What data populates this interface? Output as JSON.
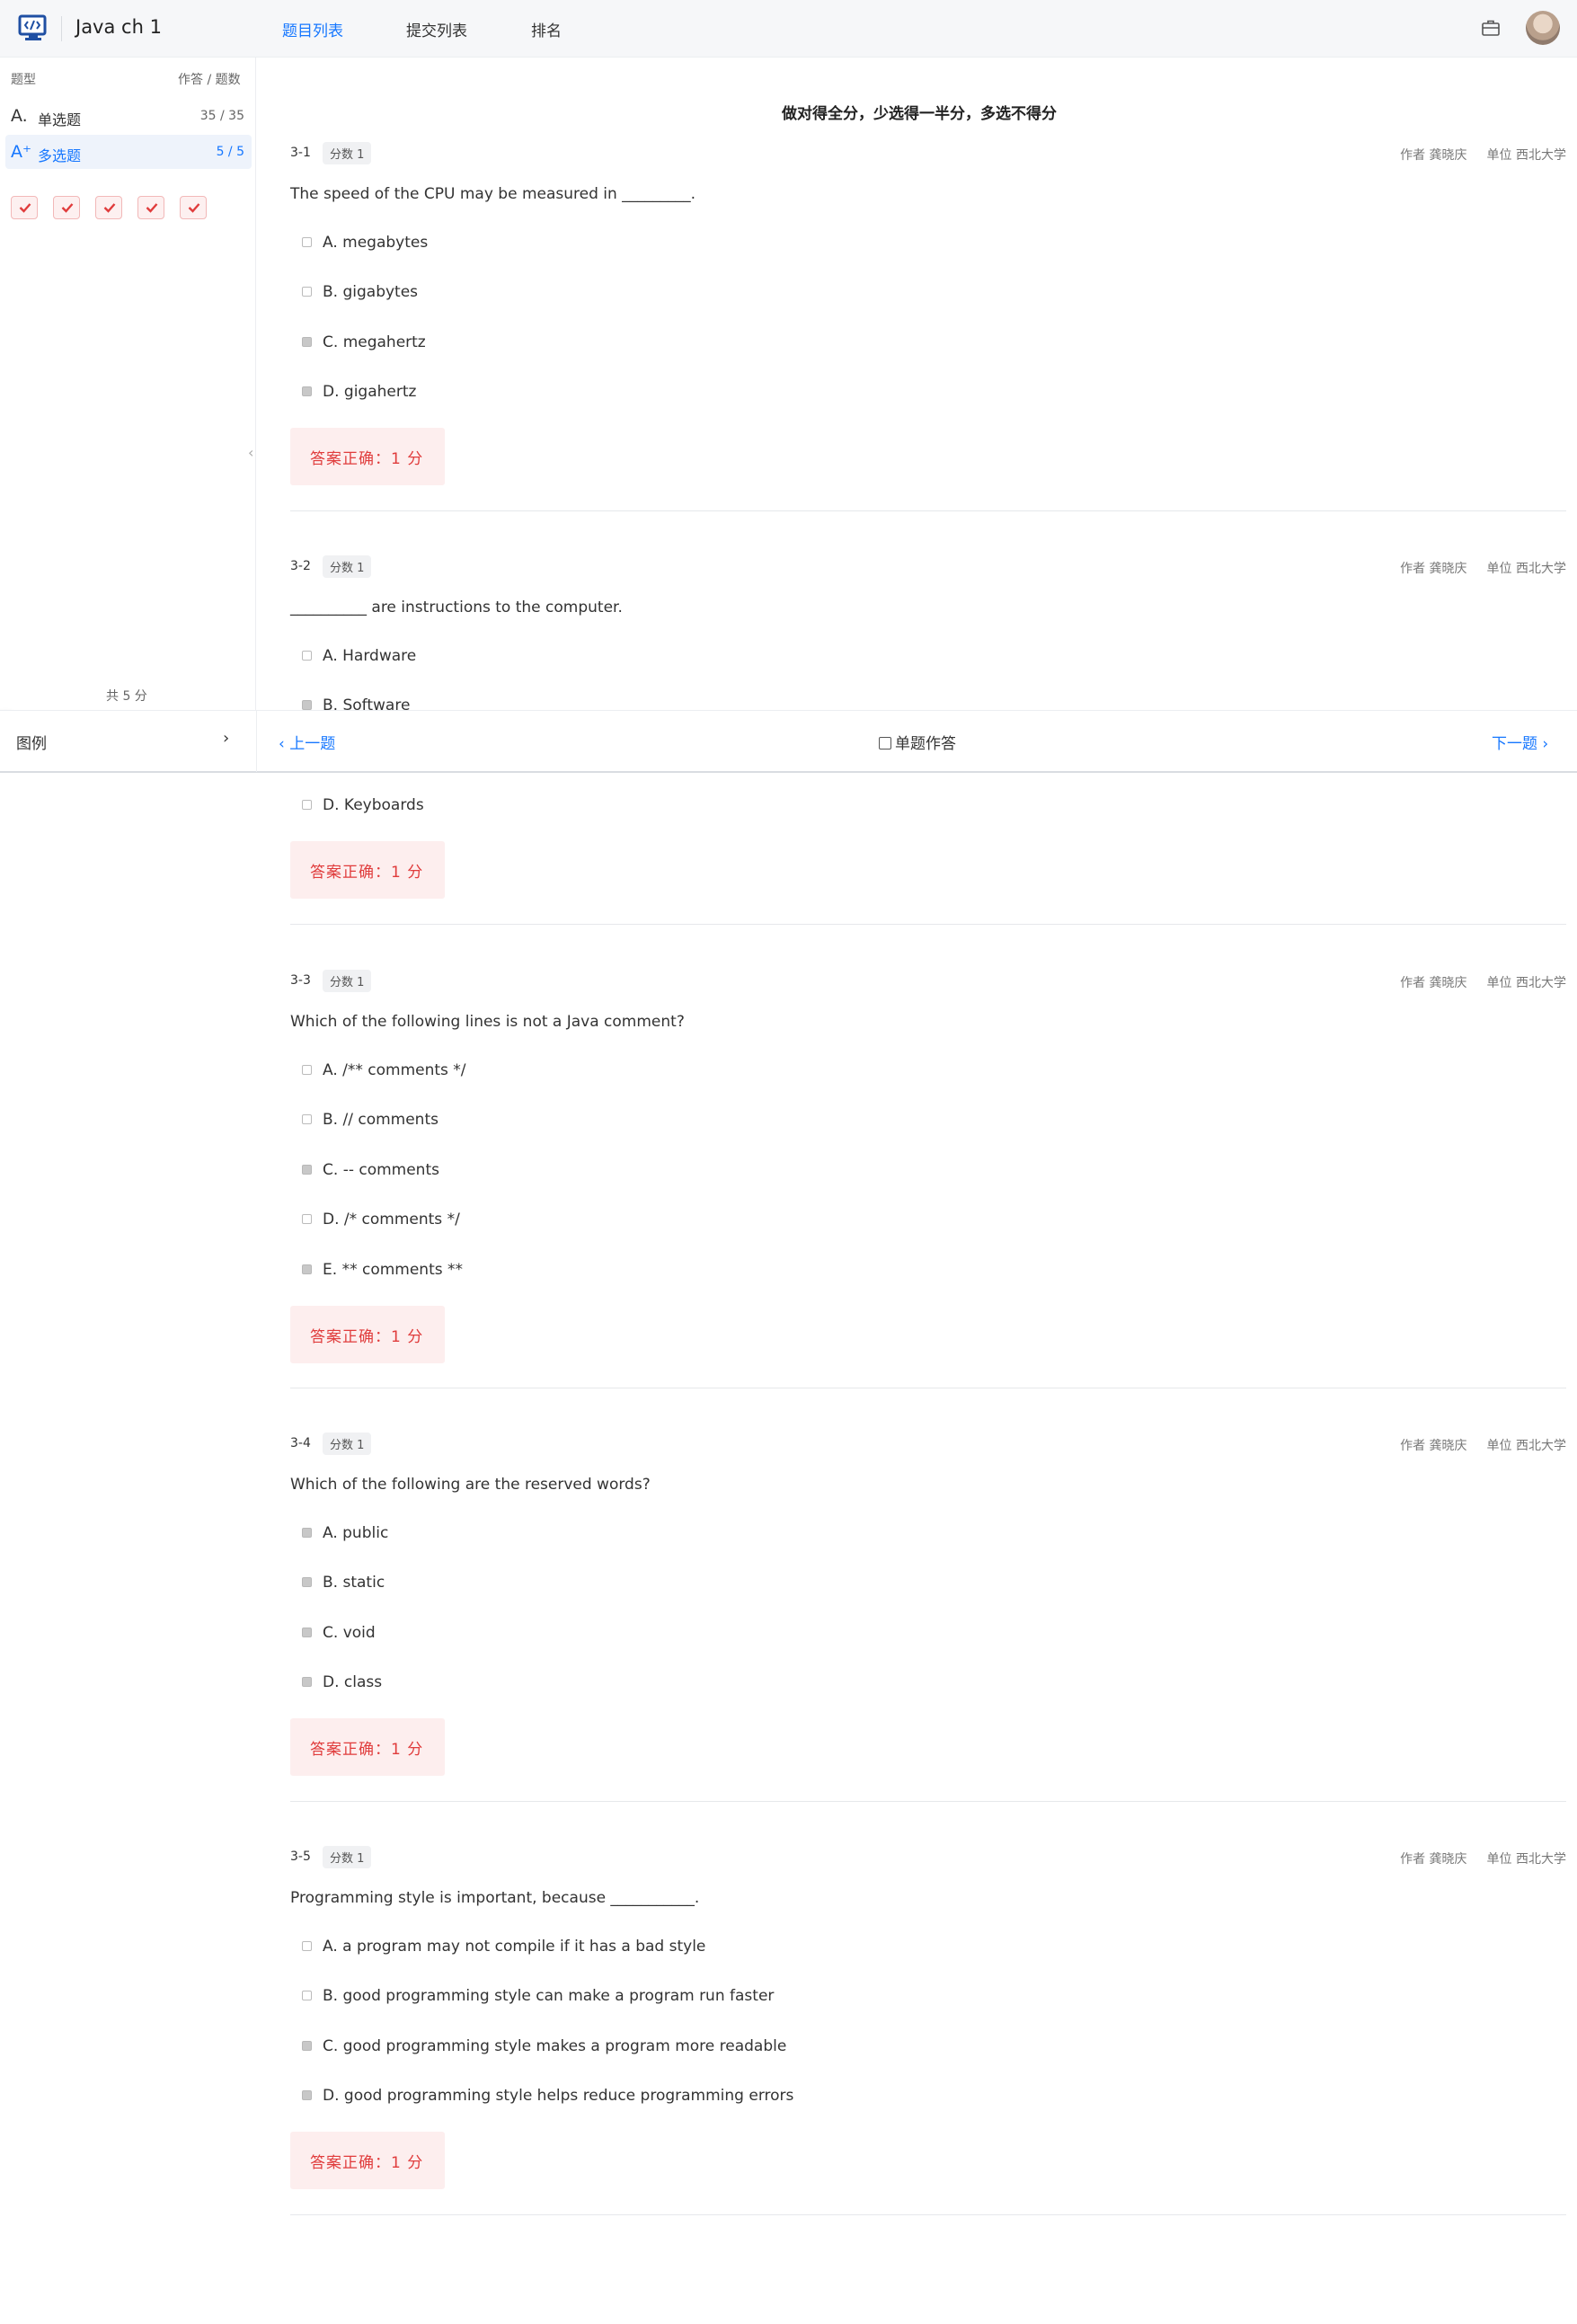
{
  "header": {
    "app_title": "Java ch 1",
    "tabs": [
      "题目列表",
      "提交列表",
      "排名"
    ],
    "active_tab": 0
  },
  "sidebar": {
    "col_type": "题型",
    "col_progress": "作答 / 题数",
    "rows": [
      {
        "icon": "A.",
        "label": "单选题",
        "count": "35 / 35"
      },
      {
        "icon": "A⁺",
        "label": "多选题",
        "count": "5 / 5"
      }
    ],
    "answered_marks": 5,
    "total": "共 5 分"
  },
  "footer": {
    "legend": "图例",
    "prev": "上一题",
    "single_mode": "单题作答",
    "next": "下一题"
  },
  "content": {
    "rule": "做对得全分，少选得一半分，多选不得分",
    "questions": [
      {
        "no": "3-1",
        "score": "分数 1",
        "author": "作者 龚晓庆",
        "unit": "单位 西北大学",
        "stem": "The speed of the CPU may be measured in _________.",
        "options": [
          {
            "key": "A.",
            "text": "megabytes",
            "checked": false
          },
          {
            "key": "B.",
            "text": "gigabytes",
            "checked": false
          },
          {
            "key": "C.",
            "text": "megahertz",
            "checked": true
          },
          {
            "key": "D.",
            "text": "gigahertz",
            "checked": true
          }
        ],
        "result": "答案正确：1 分"
      },
      {
        "no": "3-2",
        "score": "分数 1",
        "author": "作者 龚晓庆",
        "unit": "单位 西北大学",
        "stem": "__________ are instructions to the computer.",
        "options": [
          {
            "key": "A.",
            "text": "Hardware",
            "checked": false
          },
          {
            "key": "B.",
            "text": "Software",
            "checked": true
          },
          {
            "key": "D.",
            "text": "Keyboards",
            "checked": false
          }
        ],
        "result": "答案正确：1 分"
      },
      {
        "no": "3-3",
        "score": "分数 1",
        "author": "作者 龚晓庆",
        "unit": "单位 西北大学",
        "stem": "Which of the following lines is not a Java comment?",
        "options": [
          {
            "key": "A.",
            "text": "/** comments */",
            "checked": false
          },
          {
            "key": "B.",
            "text": "// comments",
            "checked": false
          },
          {
            "key": "C.",
            "text": "-- comments",
            "checked": true
          },
          {
            "key": "D.",
            "text": "/* comments */",
            "checked": false
          },
          {
            "key": "E.",
            "text": "** comments **",
            "checked": true
          }
        ],
        "result": "答案正确：1 分"
      },
      {
        "no": "3-4",
        "score": "分数 1",
        "author": "作者 龚晓庆",
        "unit": "单位 西北大学",
        "stem": "Which of the following are the reserved words?",
        "options": [
          {
            "key": "A.",
            "text": "public",
            "checked": true
          },
          {
            "key": "B.",
            "text": "static",
            "checked": true
          },
          {
            "key": "C.",
            "text": "void",
            "checked": true
          },
          {
            "key": "D.",
            "text": "class",
            "checked": true
          }
        ],
        "result": "答案正确：1 分"
      },
      {
        "no": "3-5",
        "score": "分数 1",
        "author": "作者 龚晓庆",
        "unit": "单位 西北大学",
        "stem": "Programming style is important, because ___________.",
        "options": [
          {
            "key": "A.",
            "text": "a program may not compile if it has a bad style",
            "checked": false
          },
          {
            "key": "B.",
            "text": "good programming style can make a program run faster",
            "checked": false
          },
          {
            "key": "C.",
            "text": "good programming style makes a program more readable",
            "checked": true
          },
          {
            "key": "D.",
            "text": "good programming style helps reduce programming errors",
            "checked": true
          }
        ],
        "result": "答案正确：1 分"
      }
    ]
  },
  "colors": {
    "accent": "#1677ff",
    "correct_bg": "#fdeeee",
    "correct_text": "#e03c3c"
  }
}
